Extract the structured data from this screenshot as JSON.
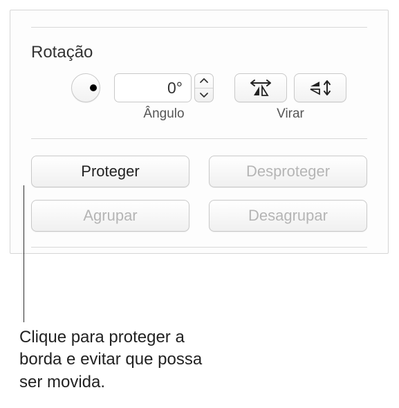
{
  "section": {
    "title": "Rotação"
  },
  "rotation": {
    "angle_value": "0°",
    "angle_label": "Ângulo",
    "flip_label": "Virar"
  },
  "buttons": {
    "protect": "Proteger",
    "unprotect": "Desproteger",
    "group": "Agrupar",
    "ungroup": "Desagrupar"
  },
  "callout": {
    "text": "Clique para proteger a borda e evitar que possa ser movida."
  }
}
